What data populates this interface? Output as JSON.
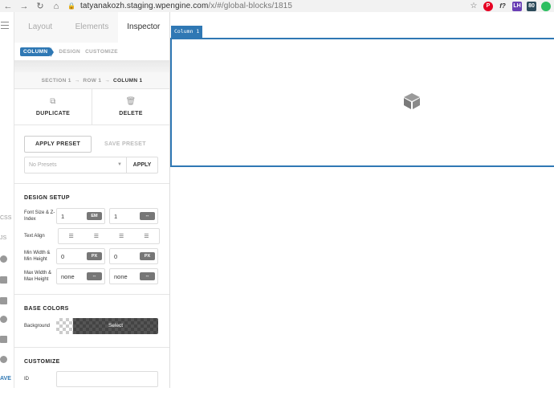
{
  "browser": {
    "back": "←",
    "forward": "→",
    "reload": "↻",
    "home": "⌂",
    "lock": "🔒",
    "url_host": "tatyanakozh.staging.wpengine.com",
    "url_path": "/x/#/global-blocks/1815",
    "extensions": [
      {
        "name": "star-icon",
        "label": "☆",
        "color": "#ffffff"
      },
      {
        "name": "pinterest-icon",
        "label": "P",
        "color": "#e60023"
      },
      {
        "name": "f-icon",
        "label": "f?",
        "color": "#ffffff"
      },
      {
        "name": "lh-icon",
        "label": "LH",
        "color": "#6a3fb5"
      },
      {
        "name": "counter-icon",
        "label": "80",
        "color": "#2c4a5a"
      },
      {
        "name": "evernote-icon",
        "label": "",
        "color": "#2dbe60"
      }
    ]
  },
  "rail": {
    "items": [
      {
        "label": "CSS"
      },
      {
        "label": "JS"
      }
    ],
    "save_label": "AVE"
  },
  "panel": {
    "tabs": [
      {
        "label": "Layout",
        "active": false
      },
      {
        "label": "Elements",
        "active": false
      },
      {
        "label": "Inspector",
        "active": true
      }
    ],
    "subnav": {
      "active": "COLUMN",
      "items": [
        "DESIGN",
        "CUSTOMIZE"
      ]
    },
    "breadcrumb": {
      "items": [
        "SECTION 1",
        "ROW 1"
      ],
      "current": "COLUMN 1",
      "sep": "→"
    },
    "actions": {
      "duplicate": "DUPLICATE",
      "delete": "DELETE"
    },
    "presets": {
      "apply_preset": "APPLY PRESET",
      "save_preset": "SAVE PRESET",
      "select_value": "No Presets",
      "apply": "APPLY"
    },
    "design_setup": {
      "title": "DESIGN SETUP",
      "font_size_label": "Font Size & Z-Index",
      "font_size_value": "1",
      "font_size_unit": "EM",
      "z_index_value": "1",
      "z_index_unit": "--",
      "text_align_label": "Text Align",
      "min_label": "Min Width & Min Height",
      "min_width_value": "0",
      "min_width_unit": "PX",
      "min_height_value": "0",
      "min_height_unit": "PX",
      "max_label": "Max Width & Max Height",
      "max_width_value": "none",
      "max_width_unit": "--",
      "max_height_value": "none",
      "max_height_unit": "--"
    },
    "base_colors": {
      "title": "BASE COLORS",
      "background_label": "Background",
      "select_label": "Select"
    },
    "customize": {
      "title": "CUSTOMIZE",
      "id_label": "ID",
      "id_value": ""
    }
  },
  "canvas": {
    "column_tag": "Column 1",
    "accent": "#2f78b4"
  }
}
